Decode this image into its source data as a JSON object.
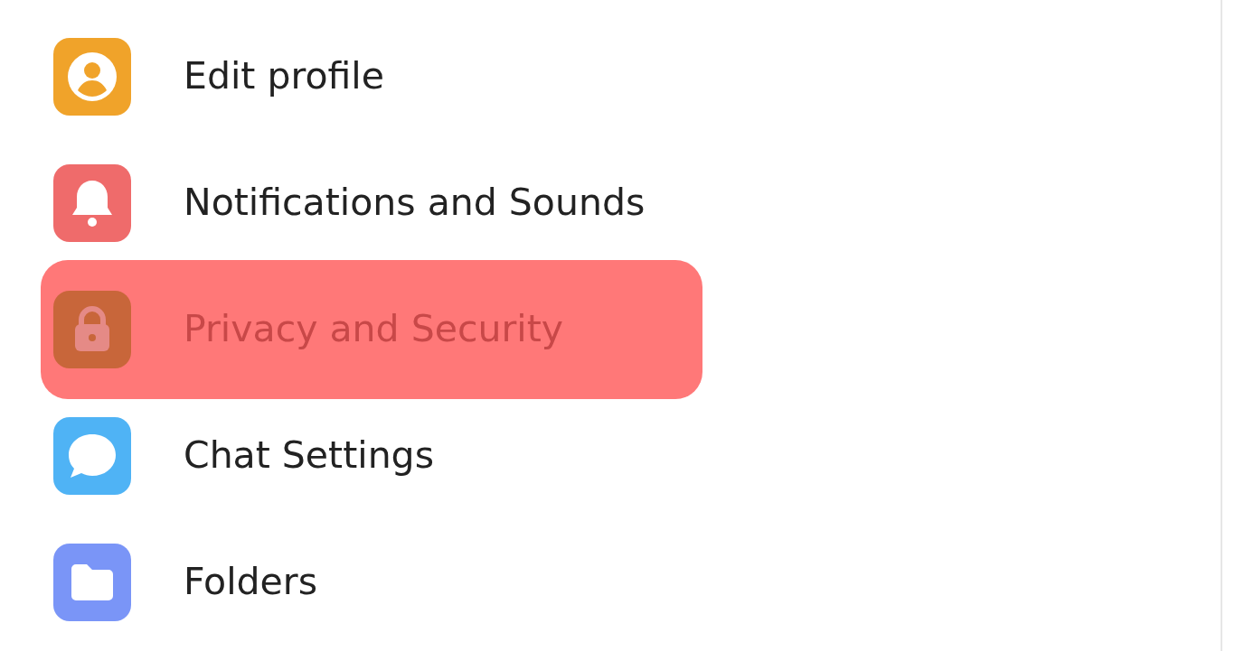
{
  "items": [
    {
      "label": "Edit profile",
      "kind": "profile",
      "color": "#f0a32a",
      "selected": false
    },
    {
      "label": "Notifications and Sounds",
      "kind": "bell",
      "color": "#ef6b6b",
      "selected": false
    },
    {
      "label": "Privacy and Security",
      "kind": "lock",
      "color": "#c8663a",
      "selected": true
    },
    {
      "label": "Chat Settings",
      "kind": "chat",
      "color": "#4fb3f5",
      "selected": false
    },
    {
      "label": "Folders",
      "kind": "folder",
      "color": "#7a95f7",
      "selected": false
    }
  ]
}
